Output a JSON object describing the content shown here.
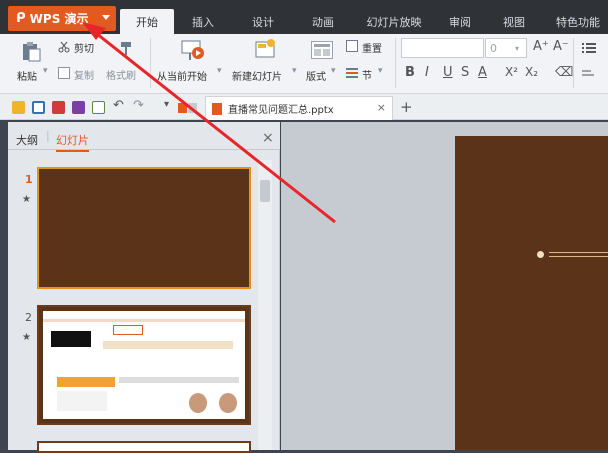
{
  "app": {
    "wps_label": "WPS 演示",
    "logo_glyph": "ᑭ"
  },
  "tabs": [
    "开始",
    "插入",
    "设计",
    "动画",
    "幻灯片放映",
    "审阅",
    "视图",
    "特色功能"
  ],
  "ribbon": {
    "cut": "剪切",
    "paste": "粘贴",
    "copy": "复制",
    "format_painter": "格式刷",
    "from_current": "从当前开始",
    "new_slide": "新建幻灯片",
    "layout": "版式",
    "reset": "重置",
    "section": "节",
    "font_size_value": "0",
    "font_buttons": [
      "B",
      "I",
      "U",
      "S",
      "A",
      "X²",
      "X₂"
    ],
    "grow_font": "A⁺",
    "shrink_font": "A⁻"
  },
  "document": {
    "tab_name": "直播常见问题汇总.pptx",
    "close": "×",
    "add": "+"
  },
  "panel": {
    "tab_outline": "大纲",
    "tab_slides": "幻灯片",
    "close": "×"
  },
  "slides": [
    {
      "number": "1",
      "star": "★"
    },
    {
      "number": "2",
      "star": "★"
    }
  ],
  "colors": {
    "accent": "#e35a20",
    "slide_bg": "#5b3318",
    "arrow": "#e8262a"
  }
}
